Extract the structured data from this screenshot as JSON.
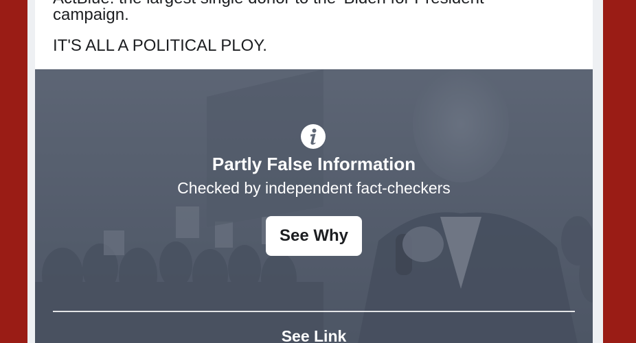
{
  "post": {
    "line_cut": "ActBlue: the largest single donor to the 'Biden for President'",
    "line_2": "campaign.",
    "line_3": "IT'S ALL A POLITICAL PLOY."
  },
  "fact_check": {
    "icon": "info-icon",
    "title": "Partly False Information",
    "subtitle": "Checked by independent fact-checkers",
    "see_why_label": "See Why",
    "see_link_label": "See Link"
  },
  "colors": {
    "frame": "#9a1c15",
    "panel": "#5d6675",
    "text_dark": "#1c1e21",
    "text_light": "#ffffff"
  }
}
